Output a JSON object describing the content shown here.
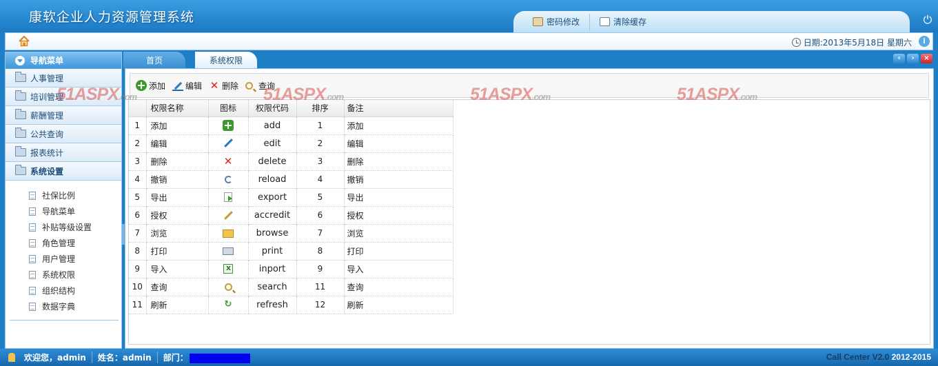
{
  "app": {
    "title": "康软企业人力资源管理系统"
  },
  "header": {
    "tools": [
      {
        "label": "密码修改",
        "icon": "password-icon"
      },
      {
        "label": "清除缓存",
        "icon": "clear-cache-icon"
      }
    ]
  },
  "topbar": {
    "date_text": "日期:2013年5月18日 星期六"
  },
  "sidebar": {
    "title": "导航菜单",
    "groups": [
      {
        "label": "人事管理"
      },
      {
        "label": "培训管理"
      },
      {
        "label": "薪酬管理"
      },
      {
        "label": "公共查询"
      },
      {
        "label": "报表统计"
      },
      {
        "label": "系统设置"
      }
    ],
    "sub_items": [
      {
        "label": "社保比例"
      },
      {
        "label": "导航菜单"
      },
      {
        "label": "补贴等级设置"
      },
      {
        "label": "角色管理"
      },
      {
        "label": "用户管理"
      },
      {
        "label": "系统权限"
      },
      {
        "label": "组织结构"
      },
      {
        "label": "数据字典"
      }
    ]
  },
  "tabs": [
    {
      "label": "首页"
    },
    {
      "label": "系统权限"
    }
  ],
  "toolbar": {
    "add_label": "添加",
    "edit_label": "编辑",
    "delete_label": "删除",
    "search_label": "查询"
  },
  "grid": {
    "columns": [
      "权限名称",
      "图标",
      "权限代码",
      "排序",
      "备注"
    ],
    "rows": [
      {
        "no": "1",
        "name": "添加",
        "icon": "add-icon",
        "code": "add",
        "order": "1",
        "note": "添加"
      },
      {
        "no": "2",
        "name": "编辑",
        "icon": "edit-icon",
        "code": "edit",
        "order": "2",
        "note": "编辑"
      },
      {
        "no": "3",
        "name": "删除",
        "icon": "delete-icon",
        "code": "delete",
        "order": "3",
        "note": "删除"
      },
      {
        "no": "4",
        "name": "撤销",
        "icon": "reload-icon",
        "code": "reload",
        "order": "4",
        "note": "撤销"
      },
      {
        "no": "5",
        "name": "导出",
        "icon": "export-icon",
        "code": "export",
        "order": "5",
        "note": "导出"
      },
      {
        "no": "6",
        "name": "授权",
        "icon": "accredit-icon",
        "code": "accredit",
        "order": "6",
        "note": "授权"
      },
      {
        "no": "7",
        "name": "浏览",
        "icon": "browse-icon",
        "code": "browse",
        "order": "7",
        "note": "浏览"
      },
      {
        "no": "8",
        "name": "打印",
        "icon": "print-icon",
        "code": "print",
        "order": "8",
        "note": "打印"
      },
      {
        "no": "9",
        "name": "导入",
        "icon": "inport-icon",
        "code": "inport",
        "order": "9",
        "note": "导入"
      },
      {
        "no": "10",
        "name": "查询",
        "icon": "search-icon",
        "code": "search",
        "order": "11",
        "note": "查询"
      },
      {
        "no": "11",
        "name": "刷新",
        "icon": "refresh-icon",
        "code": "refresh",
        "order": "12",
        "note": "刷新"
      }
    ]
  },
  "watermarks": [
    {
      "main": "51ASPX",
      "suffix": ".com"
    },
    {
      "main": "51ASPX",
      "suffix": ".com"
    },
    {
      "main": "51ASPX",
      "suffix": ".com"
    },
    {
      "main": "51ASPX",
      "suffix": ".com"
    }
  ],
  "footer": {
    "welcome": "欢迎您，admin",
    "name": "姓名：admin",
    "dept_label": "部门：",
    "product": "Call Center V2.0",
    "years": "2012-2015"
  }
}
